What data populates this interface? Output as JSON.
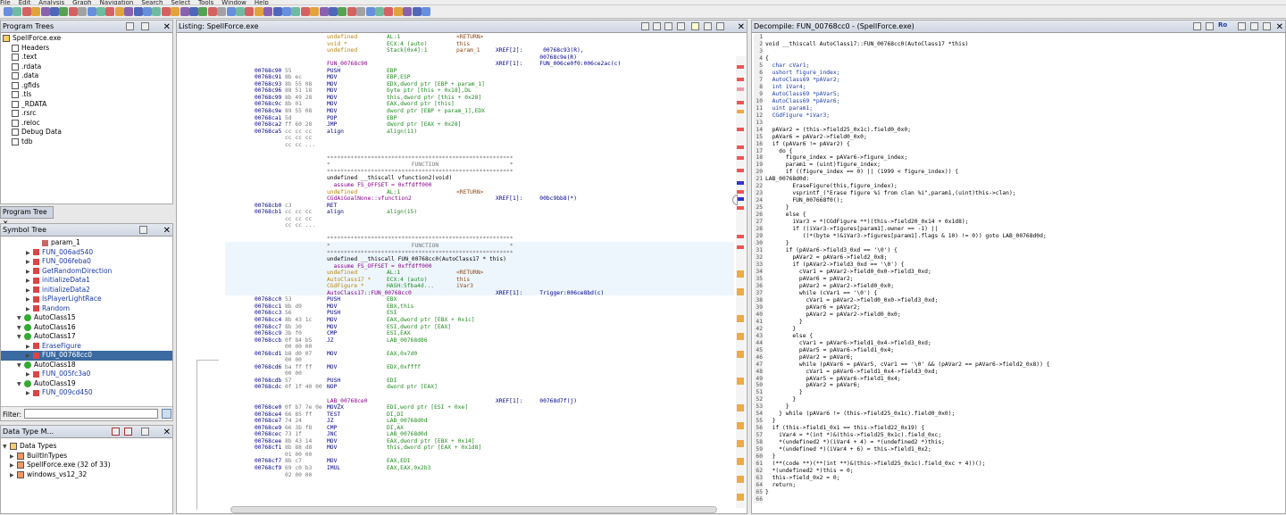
{
  "menu": [
    "File",
    "Edit",
    "Analysis",
    "Graph",
    "Navigation",
    "Search",
    "Select",
    "Tools",
    "Window",
    "Help"
  ],
  "program_trees": {
    "title": "Program Trees",
    "root": "SpellForce.exe",
    "items": [
      "Headers",
      ".text",
      ".rdata",
      ".data",
      ".gfids",
      ".tls",
      "_RDATA",
      ".rsrc",
      ".reloc",
      "Debug Data",
      "tdb"
    ],
    "tab": "Program Tree"
  },
  "symbol_tree": {
    "title": "Symbol Tree",
    "items": [
      {
        "label": "param_1",
        "kind": "param",
        "indent": 4
      },
      {
        "label": "FUN_006ad540",
        "kind": "fn",
        "indent": 3
      },
      {
        "label": "FUN_006feba0",
        "kind": "fn",
        "indent": 3
      },
      {
        "label": "GetRandomDirection",
        "kind": "fn",
        "indent": 3
      },
      {
        "label": "initializeData1",
        "kind": "fn",
        "indent": 3
      },
      {
        "label": "initializeData2",
        "kind": "fn",
        "indent": 3
      },
      {
        "label": "IsPlayerLightRace",
        "kind": "fn",
        "indent": 3
      },
      {
        "label": "Random",
        "kind": "fn",
        "indent": 3
      },
      {
        "label": "AutoClass15",
        "kind": "class",
        "indent": 2
      },
      {
        "label": "AutoClass16",
        "kind": "class",
        "indent": 2
      },
      {
        "label": "AutoClass17",
        "kind": "class",
        "indent": 2
      },
      {
        "label": "EraseFigure",
        "kind": "fn",
        "indent": 3
      },
      {
        "label": "FUN_00768cc0",
        "kind": "fn",
        "indent": 3,
        "selected": true
      },
      {
        "label": "AutoClass18",
        "kind": "class",
        "indent": 2
      },
      {
        "label": "FUN_005fc3a0",
        "kind": "fn",
        "indent": 3
      },
      {
        "label": "AutoClass19",
        "kind": "class",
        "indent": 2
      },
      {
        "label": "FUN_009cd450",
        "kind": "fn",
        "indent": 3
      }
    ],
    "filter_label": "Filter:"
  },
  "data_type_manager": {
    "title": "Data Type M...",
    "items": [
      {
        "label": "Data Types",
        "indent": 0
      },
      {
        "label": "BuiltInTypes",
        "indent": 1
      },
      {
        "label": "SpellForce.exe (32 of 33)",
        "indent": 1
      },
      {
        "label": "windows_vs12_32",
        "indent": 1
      }
    ]
  },
  "listing": {
    "title": "Listing:  SpellForce.exe",
    "lines": [
      [
        "",
        "",
        "undefined",
        "AL:1",
        "<RETURN>",
        ""
      ],
      [
        "",
        "",
        "void *",
        "ECX:4 (auto)",
        "this",
        ""
      ],
      [
        "",
        "",
        "undefined",
        "Stack[0x4]:1",
        "param_1",
        "XREF[2]:      00768c93(R),"
      ],
      [
        "",
        "",
        "",
        "",
        "",
        "             00768c9e(R)"
      ],
      [
        "",
        "",
        "FUN_00768c90",
        "",
        "",
        "XREF[1]:     FUN_006ce0f0:006ce2ac(c)"
      ],
      [
        "00768c90",
        "55",
        "PUSH",
        "EBP",
        "",
        ""
      ],
      [
        "00768c91",
        "8b ec",
        "MOV",
        "EBP,ESP",
        "",
        ""
      ],
      [
        "00768c93",
        "8b 55 08",
        "MOV",
        "EDX,dword ptr [EBP + param_1]",
        "",
        ""
      ],
      [
        "00768c96",
        "88 51 18",
        "MOV",
        "byte ptr [this + 0x18],DL",
        "",
        ""
      ],
      [
        "00768c99",
        "8b 49 28",
        "MOV",
        "this,dword ptr [this + 0x28]",
        "",
        ""
      ],
      [
        "00768c9c",
        "8b 01",
        "MOV",
        "EAX,dword ptr [this]",
        "",
        ""
      ],
      [
        "00768c9e",
        "89 55 08",
        "MOV",
        "dword ptr [EBP + param_1],EDX",
        "",
        ""
      ],
      [
        "00768ca1",
        "5d",
        "POP",
        "EBP",
        "",
        ""
      ],
      [
        "00768ca2",
        "ff 60 28",
        "JMP",
        "dword ptr [EAX + 0x28]",
        "",
        ""
      ],
      [
        "00768ca5",
        "cc cc cc",
        "align",
        "align(11)",
        "",
        ""
      ],
      [
        "",
        "cc cc cc",
        "",
        "",
        "",
        ""
      ],
      [
        "",
        "cc cc ...",
        "",
        "",
        "",
        ""
      ],
      [
        "",
        "",
        "",
        "",
        "",
        ""
      ],
      [
        "",
        "",
        "*******************************************************",
        "",
        "",
        ""
      ],
      [
        "",
        "",
        "*                        FUNCTION                     *",
        "",
        "",
        ""
      ],
      [
        "",
        "",
        "*******************************************************",
        "",
        "",
        ""
      ],
      [
        "",
        "",
        "undefined __thiscall vfunction2(void)",
        "",
        "",
        ""
      ],
      [
        "",
        "",
        "  assume FS_OFFSET = 0xffdff000",
        "",
        "",
        ""
      ],
      [
        "",
        "",
        "undefined",
        "AL:1",
        "<RETURN>",
        ""
      ],
      [
        "",
        "",
        "CGdAiGoalNone::vfunction2",
        "",
        "",
        "XREF[1]:     00bc9bb8(*)"
      ],
      [
        "00768cb0",
        "c3",
        "RET",
        "",
        "",
        ""
      ],
      [
        "00768cb1",
        "cc cc cc",
        "align",
        "align(15)",
        "",
        ""
      ],
      [
        "",
        "cc cc cc",
        "",
        "",
        "",
        ""
      ],
      [
        "",
        "cc cc ...",
        "",
        "",
        "",
        ""
      ],
      [
        "",
        "",
        "",
        "",
        "",
        ""
      ],
      [
        "",
        "",
        "*******************************************************",
        "",
        "",
        ""
      ],
      [
        "",
        "",
        "*                        FUNCTION                     *",
        "",
        "",
        ""
      ],
      [
        "",
        "",
        "*******************************************************",
        "",
        "",
        ""
      ],
      [
        "",
        "",
        "undefined __thiscall FUN_00768cc0(AutoClass17 * this)",
        "",
        "",
        ""
      ],
      [
        "",
        "",
        "  assume FS_OFFSET = 0xffdff000",
        "",
        "",
        ""
      ],
      [
        "",
        "",
        "undefined",
        "AL:1",
        "<RETURN>",
        ""
      ],
      [
        "",
        "",
        "AutoClass17 *",
        "ECX:4 (auto)",
        "this",
        ""
      ],
      [
        "",
        "",
        "CGdFigure *",
        "HASH:5fba4d...",
        "iVar3",
        ""
      ],
      [
        "",
        "",
        "AutoClass17::FUN_00768cc0",
        "",
        "",
        "XREF[1]:     Trigger:006ce8bd(c)"
      ],
      [
        "00768cc0",
        "53",
        "PUSH",
        "EBX",
        "",
        ""
      ],
      [
        "00768cc1",
        "8b d9",
        "MOV",
        "EBX,this",
        "",
        ""
      ],
      [
        "00768cc3",
        "56",
        "PUSH",
        "ESI",
        "",
        ""
      ],
      [
        "00768cc4",
        "8b 43 1c",
        "MOV",
        "EAX,dword ptr [EBX + 0x1c]",
        "",
        ""
      ],
      [
        "00768cc7",
        "8b 30",
        "MOV",
        "ESI,dword ptr [EAX]",
        "",
        ""
      ],
      [
        "00768cc9",
        "3b f0",
        "CMP",
        "ESI,EAX",
        "",
        ""
      ],
      [
        "00768ccb",
        "0f 84 b5",
        "JZ",
        "LAB_00768d86",
        "",
        ""
      ],
      [
        "",
        "00 00 00",
        "",
        "",
        "",
        ""
      ],
      [
        "00768cd1",
        "b8 d0 07",
        "MOV",
        "EAX,0x7d0",
        "",
        ""
      ],
      [
        "",
        "00 00",
        "",
        "",
        "",
        ""
      ],
      [
        "00768cd6",
        "ba ff ff",
        "MOV",
        "EDX,0xffff",
        "",
        ""
      ],
      [
        "",
        "00 00",
        "",
        "",
        "",
        ""
      ],
      [
        "00768cdb",
        "57",
        "PUSH",
        "EDI",
        "",
        ""
      ],
      [
        "00768cdc",
        "0f 1f 40 00",
        "NOP",
        "dword ptr [EAX]",
        "",
        ""
      ],
      [
        "",
        "",
        "",
        "",
        "",
        ""
      ],
      [
        "",
        "",
        "LAB_00768ce0",
        "",
        "",
        "XREF[1]:     00768d7f(j)"
      ],
      [
        "00768ce0",
        "0f b7 7e 0e",
        "MOVZX",
        "EDI,word ptr [ESI + 0xe]",
        "",
        ""
      ],
      [
        "00768ce4",
        "66 85 ff",
        "TEST",
        "DI,DI",
        "",
        ""
      ],
      [
        "00768ce7",
        "74 24",
        "JZ",
        "LAB_00768d0d",
        "",
        ""
      ],
      [
        "00768ce9",
        "66 3b f8",
        "CMP",
        "DI,AX",
        "",
        ""
      ],
      [
        "00768cec",
        "73 1f",
        "JNC",
        "LAB_00768d0d",
        "",
        ""
      ],
      [
        "00768cee",
        "8b 43 14",
        "MOV",
        "EAX,dword ptr [EBX + 0x14]",
        "",
        ""
      ],
      [
        "00768cf1",
        "8b 88 d8",
        "MOV",
        "this,dword ptr [EAX + 0x1d8]",
        "",
        ""
      ],
      [
        "",
        "01 00 00",
        "",
        "",
        "",
        ""
      ],
      [
        "00768cf7",
        "8b c7",
        "MOV",
        "EAX,EDI",
        "",
        ""
      ],
      [
        "00768cf9",
        "69 c0 b3",
        "IMUL",
        "EAX,EAX,0x2b3",
        "",
        ""
      ],
      [
        "",
        "02 00 00",
        "",
        "",
        "",
        ""
      ]
    ]
  },
  "decompile": {
    "title": "Decompile: FUN_00768cc0 - (SpellForce.exe)",
    "lines": [
      "",
      "void __thiscall AutoClass17::FUN_00768cc0(AutoClass17 *this)",
      "",
      "{",
      "  char cVar1;",
      "  ushort figure_index;",
      "  AutoClass69 *pAVar2;",
      "  int iVar4;",
      "  AutoClass69 *pAVar5;",
      "  AutoClass69 *pAVar6;",
      "  uint param1;",
      "  CGdFigure *iVar3;",
      "",
      "  pAVar2 = (this->field25_0x1c).field0_0x0;",
      "  pAVar6 = pAVar2->field0_0x0;",
      "  if (pAVar6 != pAVar2) {",
      "    do {",
      "      figure_index = pAVar6->figure_index;",
      "      param1 = (uint)figure_index;",
      "      if ((figure_index == 0) || (1999 < figure_index)) {",
      "LAB_00768d0d:",
      "        EraseFigure(this,figure_index);",
      "        vsprintf_(\"Erase figure %i from clan %i\",param1,(uint)this->clan);",
      "        FUN_007668f0();",
      "      }",
      "      else {",
      "        iVar3 = *(CGdFigure **)(this->field20_0x14 + 0x1d8);",
      "        if ((iVar3->figures[param1].owner == -1) ||",
      "           ((*(byte *)&iVar3->figures[param1].flags & 10) != 0)) goto LAB_00768d0d;",
      "      }",
      "      if (pAVar6->field3_0xd == '\\0') {",
      "        pAVar2 = pAVar6->field2_0x8;",
      "        if (pAVar2->field3_0xd == '\\0') {",
      "          cVar1 = pAVar2->field0_0x0->field3_0xd;",
      "          pAVar6 = pAVar2;",
      "          pAVar2 = pAVar2->field0_0x0;",
      "          while (cVar1 == '\\0') {",
      "            cVar1 = pAVar2->field0_0x0->field3_0xd;",
      "            pAVar6 = pAVar2;",
      "            pAVar2 = pAVar2->field0_0x0;",
      "          }",
      "        }",
      "        else {",
      "          cVar1 = pAVar6->field1_0x4->field3_0xd;",
      "          pAVar5 = pAVar6->field1_0x4;",
      "          pAVar2 = pAVar6;",
      "          while (pAVar6 = pAVar5, cVar1 == '\\0' && (pAVar2 == pAVar6->field2_0x8)) {",
      "            cVar1 = pAVar6->field1_0x4->field3_0xd;",
      "            pAVar5 = pAVar6->field1_0x4;",
      "            pAVar2 = pAVar6;",
      "          }",
      "        }",
      "      }",
      "    } while (pAVar6 != (this->field25_0x1c).field0_0x0);",
      "  }",
      "  if (this->field1_0x1 == this->field22_0x19) {",
      "    iVar4 = *(int *)&(this->field25_0x1c).field_0xc;",
      "    *(undefined2 *)(iVar4 + 4) = *(undefined2 *)this;",
      "    *(undefined *)(iVar4 + 6) = this->field1_0x2;",
      "  }",
      "  (**(code **)(**(int **)&(this->field25_0x1c).field_0xc + 4))();",
      "  *(undefined2 *)this = 0;",
      "  this->field_0x2 = 0;",
      "  return;",
      "}",
      ""
    ]
  }
}
